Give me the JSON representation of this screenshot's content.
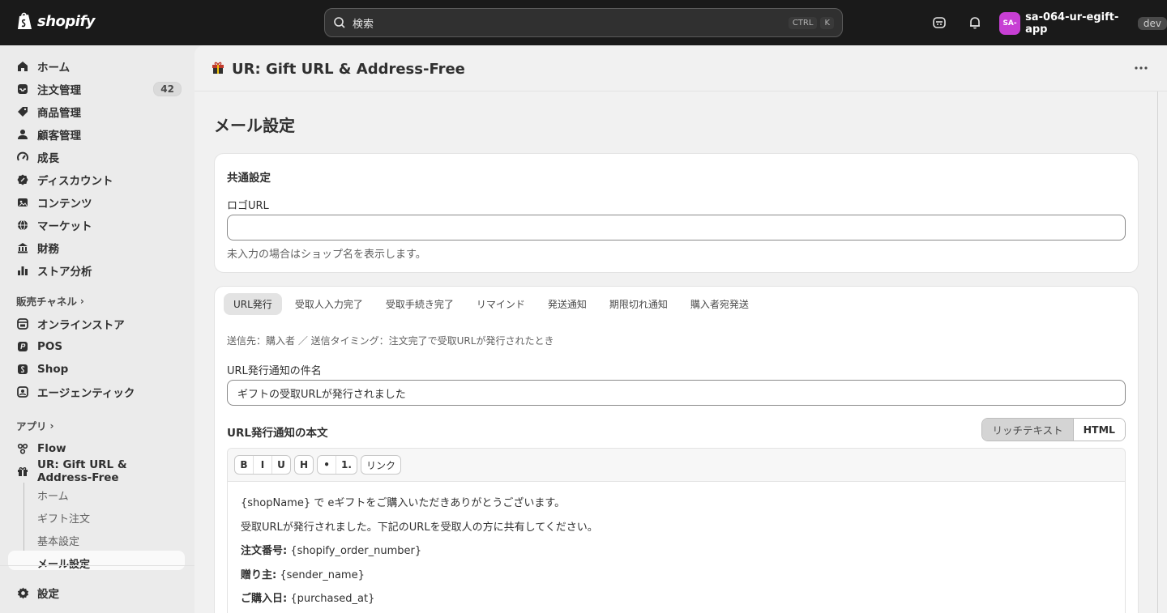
{
  "topbar": {
    "brand": "shopify",
    "search_placeholder": "検索",
    "shortcut_keys": [
      "CTRL",
      "K"
    ],
    "shop_initials": "SA-",
    "shop_name": "sa-064-ur-egift-app",
    "env_badge": "dev"
  },
  "sidebar": {
    "items": [
      {
        "label": "ホーム",
        "icon": "home-icon"
      },
      {
        "label": "注文管理",
        "icon": "inbox-icon",
        "count": "42"
      },
      {
        "label": "商品管理",
        "icon": "tag-icon"
      },
      {
        "label": "顧客管理",
        "icon": "person-icon"
      },
      {
        "label": "成長",
        "icon": "gauge-icon"
      },
      {
        "label": "ディスカウント",
        "icon": "discount-icon"
      },
      {
        "label": "コンテンツ",
        "icon": "image-icon"
      },
      {
        "label": "マーケット",
        "icon": "globe-icon"
      },
      {
        "label": "財務",
        "icon": "bank-icon"
      },
      {
        "label": "ストア分析",
        "icon": "chart-icon"
      }
    ],
    "sales_channels_heading": "販売チャネル",
    "channels": [
      {
        "label": "オンラインストア",
        "icon": "store-icon"
      },
      {
        "label": "POS",
        "icon": "pos-icon"
      },
      {
        "label": "Shop",
        "icon": "shop-icon"
      },
      {
        "label": "エージェンティック",
        "icon": "agent-icon"
      }
    ],
    "apps_heading": "アプリ",
    "apps": [
      {
        "label": "Flow",
        "icon": "flow-icon"
      },
      {
        "label": "UR: Gift URL & Address-Free",
        "icon": "gift-app-icon"
      }
    ],
    "app_subitems": [
      "ホーム",
      "ギフト注文",
      "基本設定",
      "メール設定"
    ],
    "settings_label": "設定"
  },
  "app_header": {
    "title": "UR: Gift URL & Address-Free"
  },
  "page": {
    "title": "メール設定",
    "common_card": {
      "title": "共通設定",
      "logo_label": "ロゴURL",
      "logo_value": "",
      "logo_help": "未入力の場合はショップ名を表示します。"
    },
    "tabs": [
      "URL発行",
      "受取人入力完了",
      "受取手続き完了",
      "リマインド",
      "発送通知",
      "期限切れ通知",
      "購入者宛発送"
    ],
    "active_tab": "URL発行",
    "note": "送信先：購入者 ／ 送信タイミング：注文完了で受取URLが発行されたとき",
    "subject_label": "URL発行通知の件名",
    "subject_value": "ギフトの受取URLが発行されました",
    "body_label": "URL発行通知の本文",
    "mode_toggle": {
      "rich": "リッチテキスト",
      "html": "HTML",
      "selected": "リッチテキスト"
    },
    "toolbar": {
      "bold": "B",
      "italic": "I",
      "underline": "U",
      "heading": "H",
      "bullet": "•",
      "numbered": "1.",
      "link": "リンク"
    },
    "body_lines": [
      {
        "bold": "",
        "text": "{shopName} で eギフトをご購入いただきありがとうございます。"
      },
      {
        "bold": "",
        "text": "受取URLが発行されました。下記のURLを受取人の方に共有してください。"
      },
      {
        "bold": "注文番号:",
        "text": " {shopify_order_number}"
      },
      {
        "bold": "贈り主:",
        "text": " {sender_name}"
      },
      {
        "bold": "ご購入日:",
        "text": " {purchased_at}"
      }
    ]
  }
}
